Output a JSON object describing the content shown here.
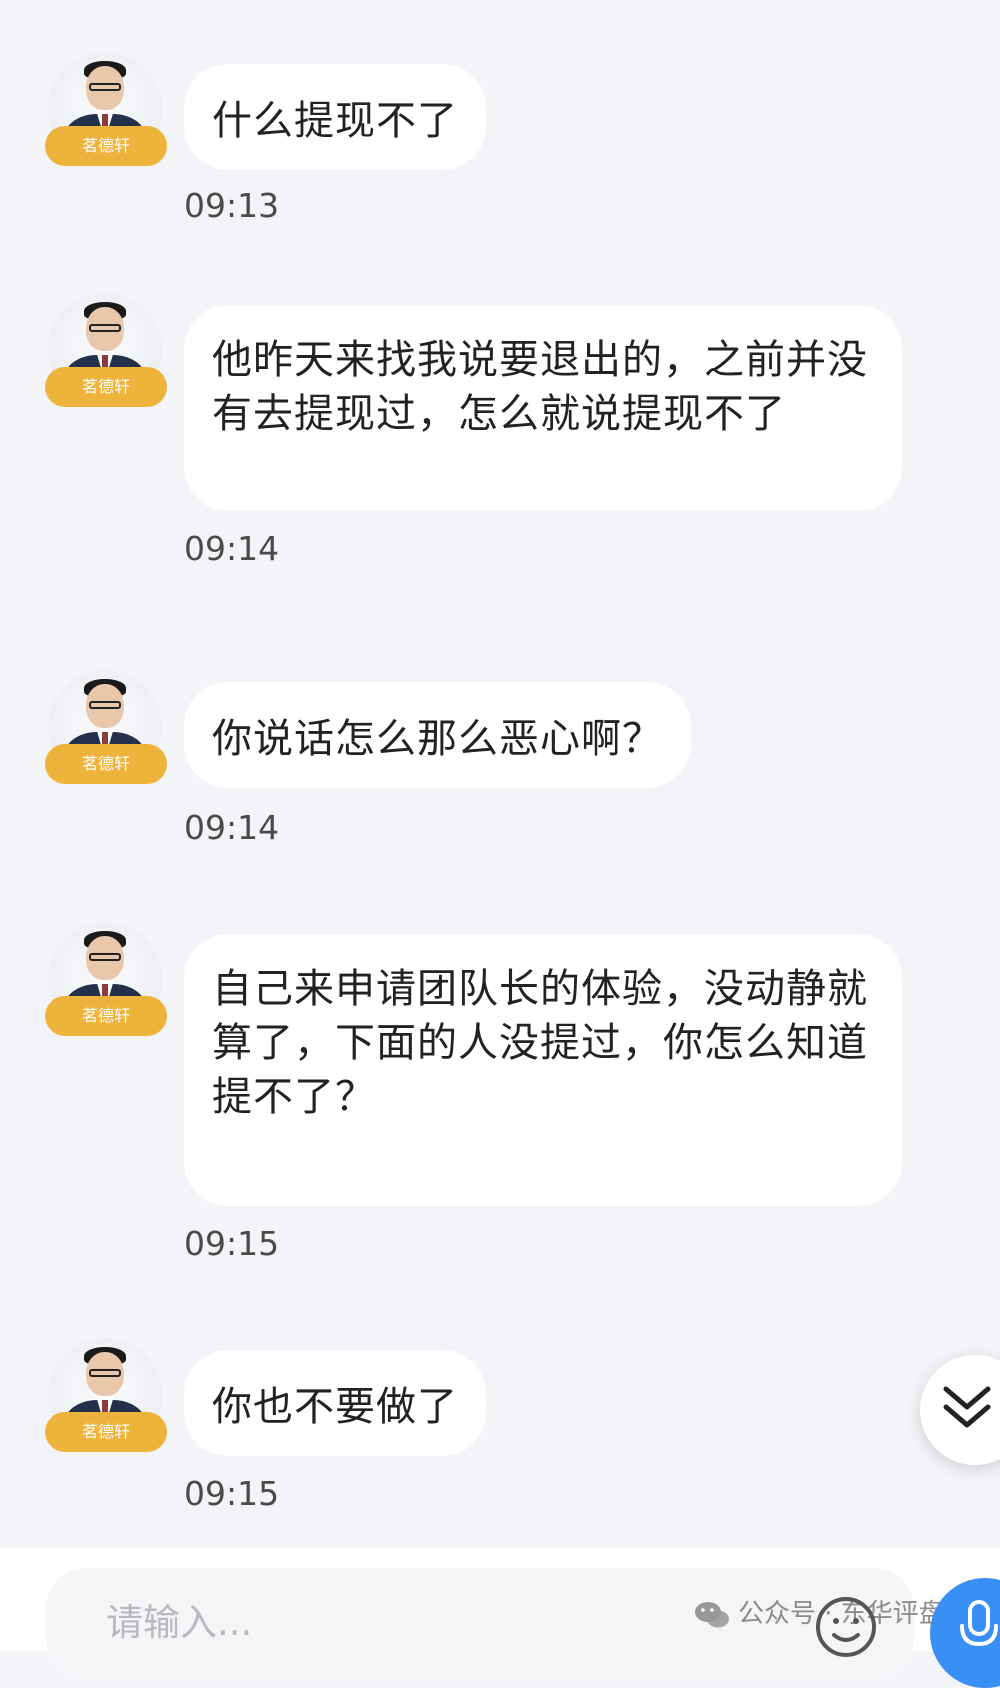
{
  "sender": {
    "name": "茗德轩"
  },
  "messages": [
    {
      "text": "什么提现不了",
      "time": "09:13"
    },
    {
      "text": "他昨天来找我说要退出的，之前并没有去提现过，怎么就说提现不了",
      "time": "09:14"
    },
    {
      "text": "你说话怎么那么恶心啊？",
      "time": "09:14"
    },
    {
      "text": "自己来申请团队长的体验，没动静就算了，下面的人没提过，你怎么知道提不了？",
      "time": "09:15"
    },
    {
      "text": "你也不要做了",
      "time": "09:15"
    }
  ],
  "input": {
    "placeholder": "请输入..."
  },
  "watermark": {
    "text": "公众号 · 东华评盘"
  },
  "icons": {
    "scroll_down": "double-chevron-down-icon",
    "emoji": "smiley-icon",
    "mic": "microphone-icon",
    "wechat": "wechat-icon"
  },
  "colors": {
    "badge": "#eeb33a",
    "mic": "#3a8ff5",
    "background": "#f3f4f7"
  }
}
